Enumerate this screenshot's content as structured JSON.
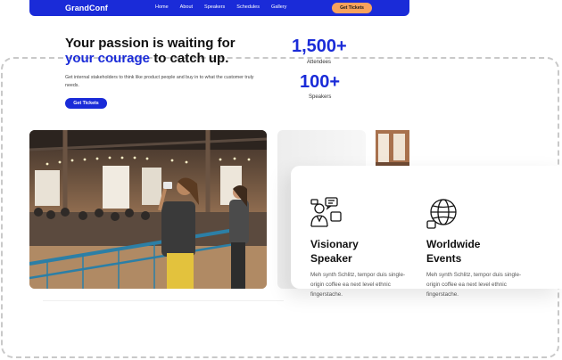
{
  "nav": {
    "logo": "GrandConf",
    "links": [
      "Home",
      "About",
      "Speakers",
      "Schedules",
      "Gallery"
    ],
    "cta": "Get Tickets"
  },
  "hero": {
    "title_line1": "Your passion is waiting for",
    "title_accent": "your courage",
    "title_rest": " to catch up.",
    "subtitle": "Get internal stakeholders to think like product people and buy in to what the customer truly needs.",
    "cta": "Get Tickets"
  },
  "stats": [
    {
      "value": "1,500+",
      "label": "Attendees"
    },
    {
      "value": "100+",
      "label": "Speakers"
    }
  ],
  "features": [
    {
      "title_line1": "Visionary",
      "title_line2": "Speaker",
      "desc": "Meh synth Schlitz, tempor duis single-origin coffee ea next level ethnic fingerstache.",
      "icon": "speaker-chat-icon"
    },
    {
      "title_line1": "Worldwide",
      "title_line2": "Events",
      "desc": "Meh synth Schlitz, tempor duis single-origin coffee ea next level ethnic fingerstache.",
      "icon": "globe-chat-icon"
    }
  ],
  "colors": {
    "accent": "#1a2bd8",
    "cta": "#f7a25c"
  }
}
